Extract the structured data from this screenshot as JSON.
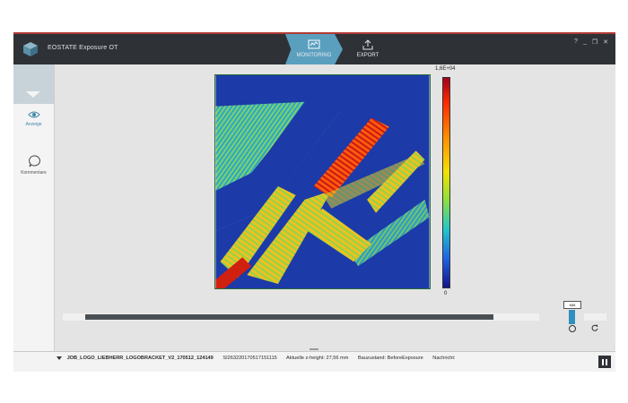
{
  "app": {
    "title": "EOSTATE Exposure OT"
  },
  "tabs": [
    {
      "label": "MONITORING",
      "icon": "monitoring-icon",
      "active": true
    },
    {
      "label": "EXPORT",
      "icon": "export-icon",
      "active": false
    }
  ],
  "window_controls": [
    "?",
    "_",
    "❐",
    "✕"
  ],
  "sidebar": {
    "items": [
      {
        "label": "Anzeige",
        "icon": "eye-icon",
        "active": true
      },
      {
        "label": "Kommentare",
        "icon": "comment-icon",
        "active": false
      }
    ]
  },
  "colorbar": {
    "max_label": "1,6E+04",
    "min_label": "0",
    "colors": [
      "#a3001a",
      "#ff2a00",
      "#ff8c00",
      "#f2e200",
      "#8fe03a",
      "#22c8c8",
      "#1e64e6",
      "#14148a"
    ]
  },
  "layer_slider": {
    "thumb_label": "688",
    "progress": 0.9
  },
  "status": {
    "job_name": "JOB_LOGO_LIEBHERR_LOGOBRACKET_V2_170512_124149",
    "job_id": "SI263220170517151115",
    "z_height": "Aktuelle z-height: 27,56 mm",
    "bauzustand": "Bauzustand: BeforeExposure",
    "nachricht": "Nachricht:"
  },
  "accent_colors": {
    "titlebar": "#2e3236",
    "tab_active": "#5b9fbf",
    "accent_red": "#b23a36"
  }
}
